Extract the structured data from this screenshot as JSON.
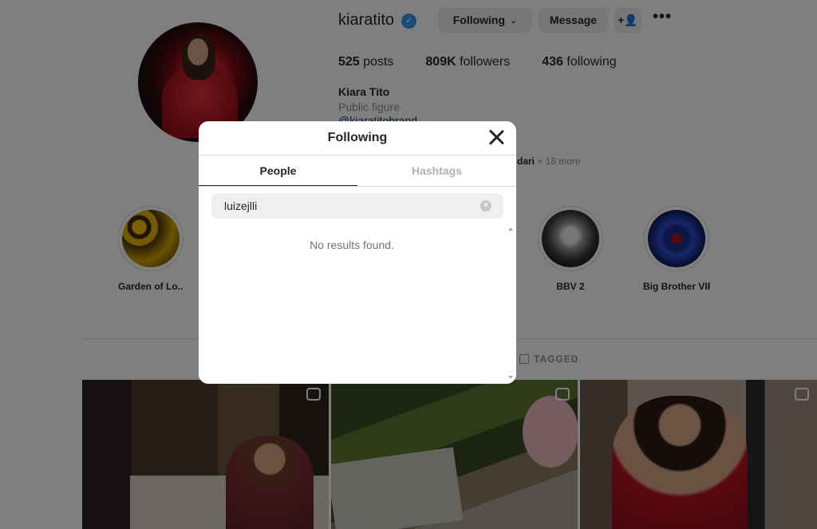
{
  "profile": {
    "username": "kiaratito",
    "following_button": "Following",
    "message_button": "Message",
    "add_user_icon": "add-person-icon",
    "more_icon": "•••",
    "stats": {
      "posts_count": "525",
      "posts_label": "posts",
      "followers_count": "809K",
      "followers_label": "followers",
      "following_count": "436",
      "following_label": "following"
    },
    "full_name": "Kiara Tito",
    "category": "Public figure",
    "threads_handle": "@kiaratitobrand",
    "followed_by_name": "dari",
    "followed_by_more": " + 18 more"
  },
  "highlights": [
    {
      "label": "Garden of Lo..."
    },
    {
      "label": "BBV 2"
    },
    {
      "label": "Big Brother VIP"
    }
  ],
  "profile_tabs": {
    "tagged": "TAGGED"
  },
  "modal": {
    "title": "Following",
    "tabs": [
      {
        "label": "People",
        "active": true
      },
      {
        "label": "Hashtags",
        "active": false
      }
    ],
    "search": {
      "value": "luizejlli"
    },
    "empty_message": "No results found."
  },
  "colors": {
    "link": "#00376b",
    "verified": "#3897f0",
    "overlay": "rgba(0,0,0,0.5)"
  }
}
